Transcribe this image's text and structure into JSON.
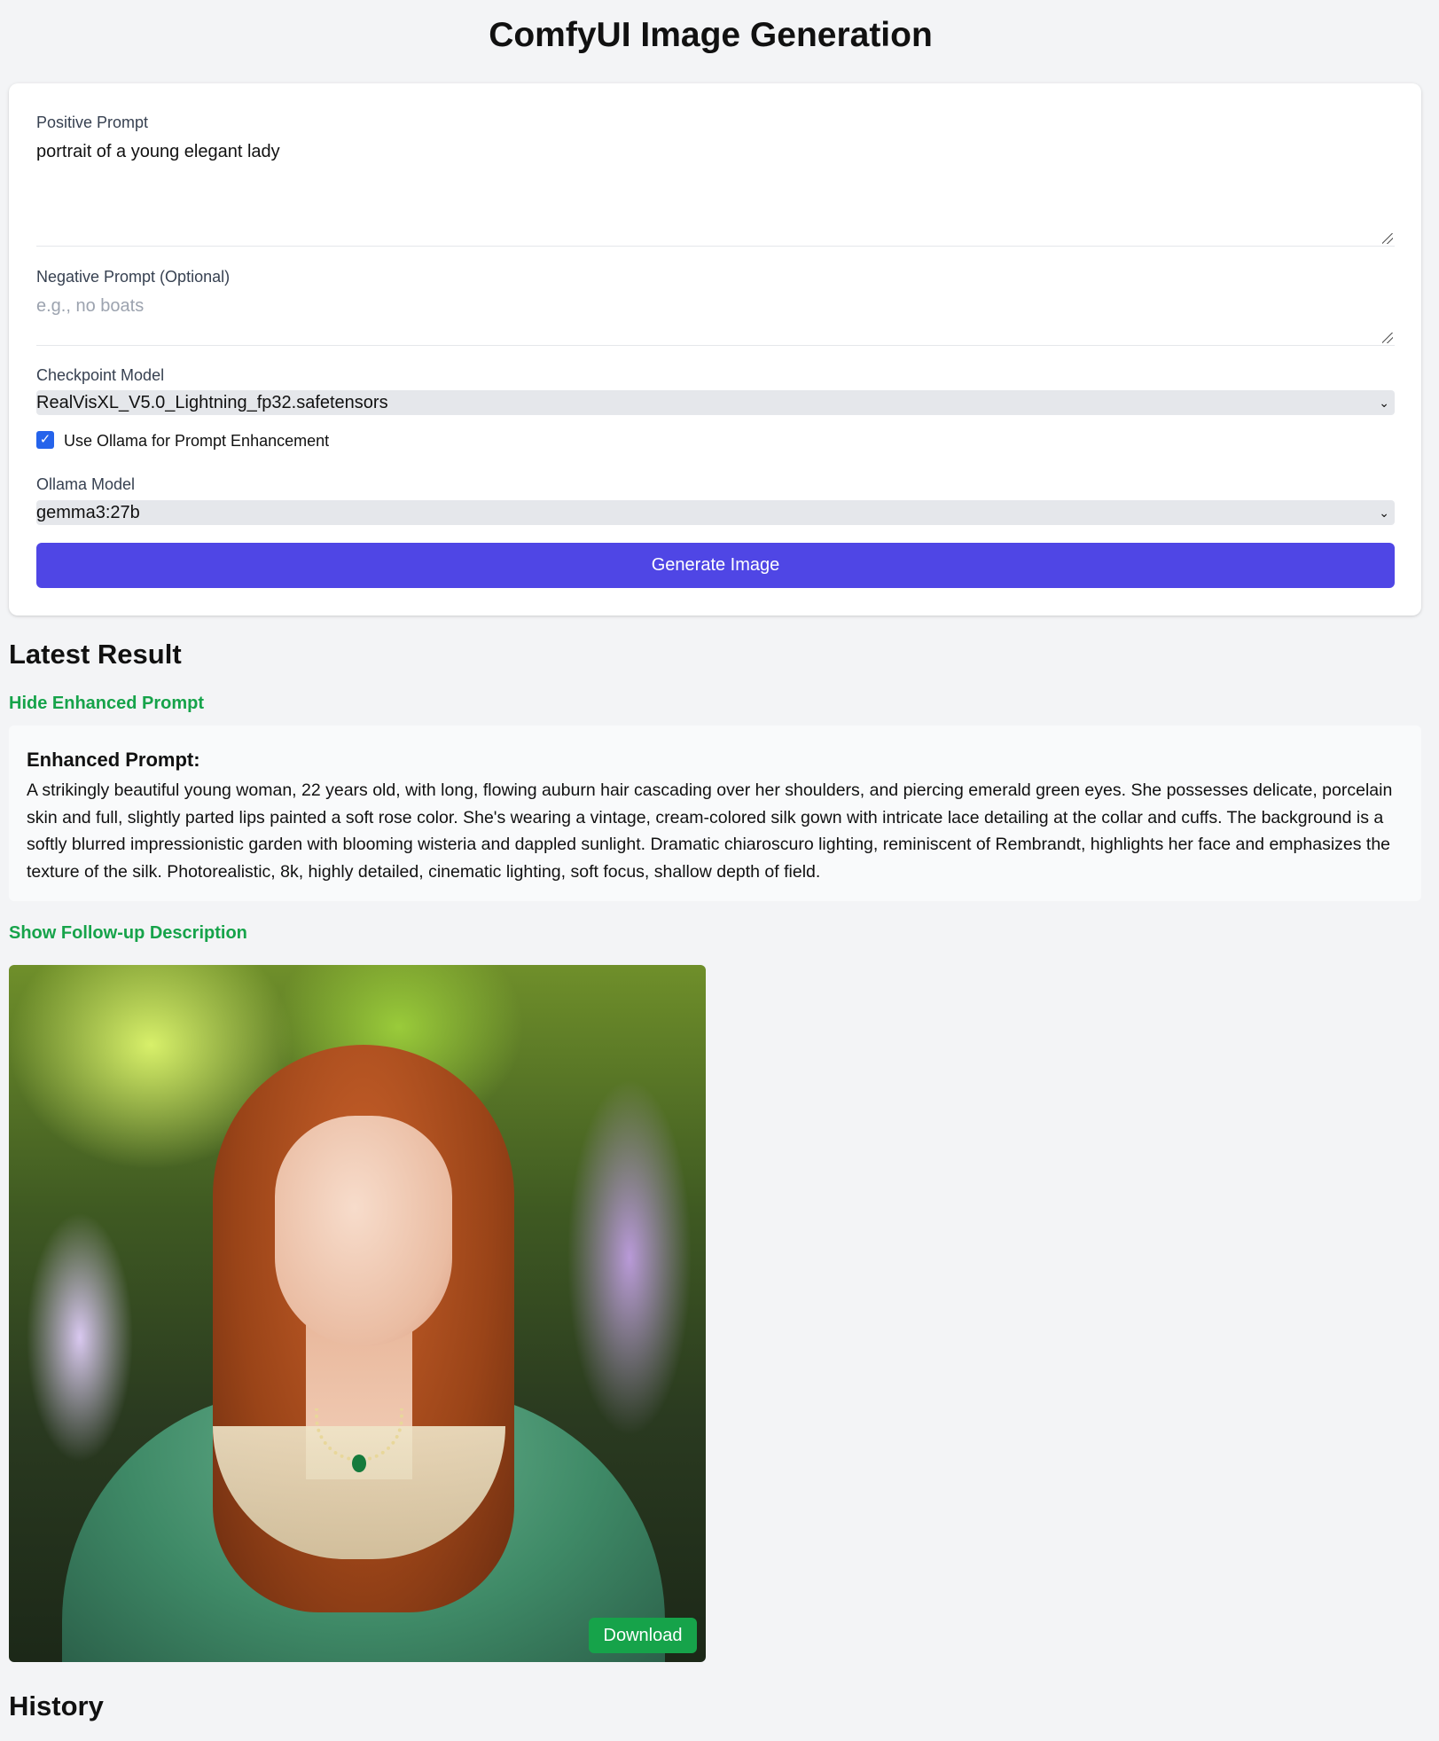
{
  "page": {
    "title": "ComfyUI Image Generation"
  },
  "form": {
    "positive_label": "Positive Prompt",
    "positive_value": "portrait of a young elegant lady",
    "negative_label": "Negative Prompt (Optional)",
    "negative_placeholder": "e.g., no boats",
    "checkpoint_label": "Checkpoint Model",
    "checkpoint_value": "RealVisXL_V5.0_Lightning_fp32.safetensors",
    "ollama_checkbox_label": "Use Ollama for Prompt Enhancement",
    "ollama_checked": true,
    "ollama_model_label": "Ollama Model",
    "ollama_model_value": "gemma3:27b",
    "generate_label": "Generate Image"
  },
  "result": {
    "heading": "Latest Result",
    "hide_enhanced_link": "Hide Enhanced Prompt",
    "enhanced_title": "Enhanced Prompt:",
    "enhanced_text": "A strikingly beautiful young woman, 22 years old, with long, flowing auburn hair cascading over her shoulders, and piercing emerald green eyes. She possesses delicate, porcelain skin and full, slightly parted lips painted a soft rose color. She's wearing a vintage, cream-colored silk gown with intricate lace detailing at the collar and cuffs. The background is a softly blurred impressionistic garden with blooming wisteria and dappled sunlight. Dramatic chiaroscuro lighting, reminiscent of Rembrandt, highlights her face and emphasizes the texture of the silk. Photorealistic, 8k, highly detailed, cinematic lighting, soft focus, shallow depth of field.",
    "followup_link": "Show Follow-up Description",
    "download_label": "Download"
  },
  "history": {
    "heading": "History"
  },
  "colors": {
    "primary": "#4f46e5",
    "success": "#16a34a",
    "checkbox": "#2563eb",
    "background": "#f3f4f6"
  },
  "icons": {
    "select_chevron": "chevron-down-icon",
    "checkbox": "checkmark-icon",
    "resize": "resize-handle-icon"
  }
}
